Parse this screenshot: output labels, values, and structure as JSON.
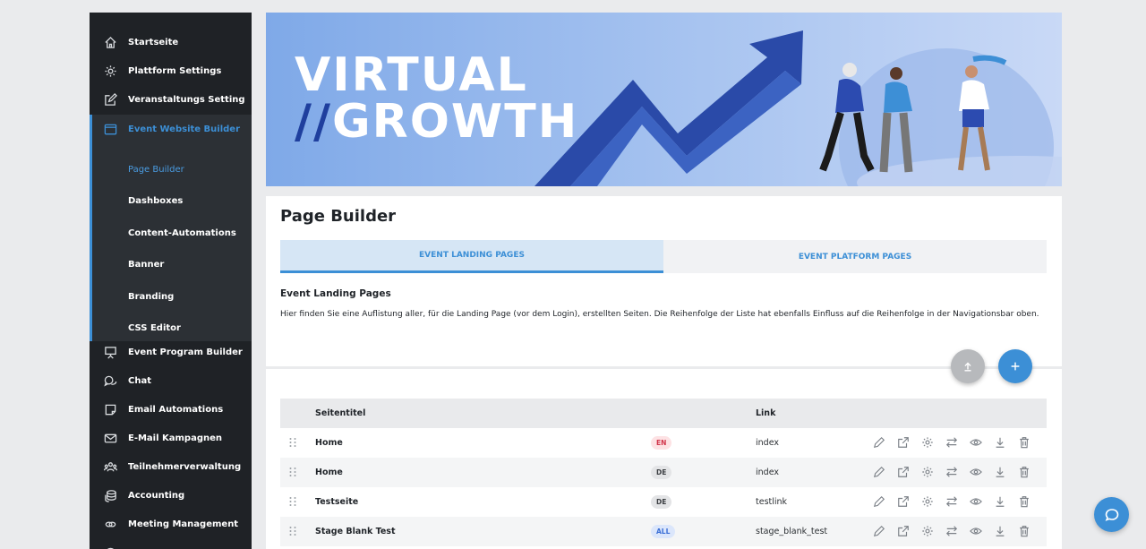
{
  "sidebar": {
    "items": [
      {
        "label": "Startseite",
        "icon": "home-icon"
      },
      {
        "label": "Plattform Settings",
        "icon": "gear-icon"
      },
      {
        "label": "Veranstaltungs Setting",
        "icon": "edit-icon"
      },
      {
        "label": "Event Website Builder",
        "icon": "window-icon"
      },
      {
        "label": "Event Program Builder",
        "icon": "presentation-icon"
      },
      {
        "label": "Chat",
        "icon": "chat-icon"
      },
      {
        "label": "Email Automations",
        "icon": "note-icon"
      },
      {
        "label": "E-Mail Kampagnen",
        "icon": "mail-icon"
      },
      {
        "label": "Teilnehmerverwaltung",
        "icon": "users-icon"
      },
      {
        "label": "Accounting",
        "icon": "coins-icon"
      },
      {
        "label": "Meeting Management",
        "icon": "link-icon"
      }
    ],
    "subitems": [
      "Page Builder",
      "Dashboxes",
      "Content-Automations",
      "Banner",
      "Branding",
      "CSS Editor"
    ]
  },
  "banner": {
    "line1": "VIRTUAL",
    "slash": "//",
    "line2": "GROWTH"
  },
  "main": {
    "title": "Page Builder",
    "tabs": [
      "EVENT LANDING PAGES",
      "EVENT PLATFORM PAGES"
    ],
    "section_heading": "Event Landing Pages",
    "section_description": "Hier finden Sie eine Auflistung aller, für die Landing Page (vor dem Login), erstellten Seiten. Die Reihenfolge der Liste hat ebenfalls Einfluss auf die Reihenfolge in der Navigationsbar oben."
  },
  "table": {
    "headers": [
      "Seitentitel",
      "Link"
    ],
    "rows": [
      {
        "title": "Home",
        "lang": "EN",
        "link": "index"
      },
      {
        "title": "Home",
        "lang": "DE",
        "link": "index"
      },
      {
        "title": "Testseite",
        "lang": "DE",
        "link": "testlink"
      },
      {
        "title": "Stage Blank Test",
        "lang": "ALL",
        "link": "stage_blank_test"
      }
    ]
  },
  "colors": {
    "accent": "#3c8fd6",
    "sidebar_bg": "#1f2226",
    "submenu_bg": "#2c3035"
  }
}
